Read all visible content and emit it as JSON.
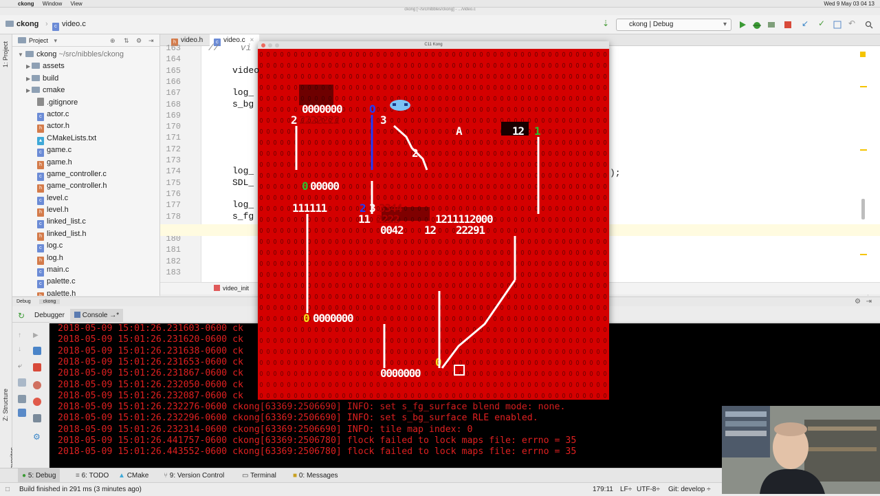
{
  "menubar": {
    "app": "ckong",
    "items": [
      "Window",
      "View"
    ],
    "clock": "Wed 9 May 03 04 13"
  },
  "window_title": "ckong [~/src/nibbles/ckong] - .../video.c",
  "navbar": {
    "project_crumb": "ckong",
    "file_crumb": "video.c",
    "run_config": "ckong | Debug"
  },
  "left_strip": {
    "project_tab": "1: Project",
    "structure_tab": "Z: Structure",
    "favorites_tab": "2: Favorites"
  },
  "project_panel": {
    "header": "Project",
    "root_name": "ckong",
    "root_path": "~/src/nibbles/ckong",
    "items": [
      {
        "label": "assets",
        "type": "folder"
      },
      {
        "label": "build",
        "type": "folder"
      },
      {
        "label": "cmake",
        "type": "folder"
      },
      {
        "label": ".gitignore",
        "type": "txt"
      },
      {
        "label": "actor.c",
        "type": "c"
      },
      {
        "label": "actor.h",
        "type": "h"
      },
      {
        "label": "CMakeLists.txt",
        "type": "cmake"
      },
      {
        "label": "game.c",
        "type": "c"
      },
      {
        "label": "game.h",
        "type": "h"
      },
      {
        "label": "game_controller.c",
        "type": "c"
      },
      {
        "label": "game_controller.h",
        "type": "h"
      },
      {
        "label": "level.c",
        "type": "c"
      },
      {
        "label": "level.h",
        "type": "h"
      },
      {
        "label": "linked_list.c",
        "type": "c"
      },
      {
        "label": "linked_list.h",
        "type": "h"
      },
      {
        "label": "log.c",
        "type": "c"
      },
      {
        "label": "log.h",
        "type": "h"
      },
      {
        "label": "main.c",
        "type": "c"
      },
      {
        "label": "palette.c",
        "type": "c"
      },
      {
        "label": "palette.h",
        "type": "h"
      }
    ]
  },
  "editor": {
    "tabs": [
      "video.h",
      "video.c"
    ],
    "line_numbers": [
      "163",
      "164",
      "165",
      "166",
      "167",
      "168",
      "169",
      "170",
      "171",
      "172",
      "173",
      "174",
      "175",
      "176",
      "177",
      "178",
      "179",
      "180",
      "181",
      "182",
      "183"
    ],
    "code": {
      "l163": "//    vi",
      "l165": "video",
      "l167": "log_",
      "l168": "s_bg",
      "l174": "log_",
      "l175": "SDL_",
      "l177": "log_",
      "l178": "s_fg"
    },
    "right_overflow": ");",
    "breadcrumb": "video_init"
  },
  "debug": {
    "label": "Debug",
    "config": "ckong",
    "tabs": [
      "Debugger",
      "Console"
    ],
    "log_lines": [
      "2018-05-09 15:01:26.231603-0600 ck",
      "2018-05-09 15:01:26.231620-0600 ck",
      "2018-05-09 15:01:26.231638-0600 ck",
      "2018-05-09 15:01:26.231653-0600 ck",
      "2018-05-09 15:01:26.231867-0600 ck",
      "2018-05-09 15:01:26.232050-0600 ck",
      "2018-05-09 15:01:26.232087-0600 ck",
      "2018-05-09 15:01:26.232276-0600 ckong[63369:2506690] INFO: set s_fg_surface blend mode: none.",
      "2018-05-09 15:01:26.232296-0600 ckong[63369:2506690] INFO: set s_bg_surface RLE enabled.",
      "2018-05-09 15:01:26.232314-0600 ckong[63369:2506690] INFO: tile map index: 0",
      "2018-05-09 15:01:26.441757-0600 ckong[63369:2506780] flock failed to lock maps file: errno = 35",
      "2018-05-09 15:01:26.443552-0600 ckong[63369:2506780] flock failed to lock maps file: errno = 35"
    ]
  },
  "bottom_tabs": [
    "5: Debug",
    "6: TODO",
    "CMake",
    "9: Version Control",
    "Terminal",
    "0: Messages"
  ],
  "status": {
    "message": "Build finished in 291 ms (3 minutes ago)",
    "position": "179:11",
    "line_sep": "LF÷",
    "encoding": "UTF-8÷",
    "git": "Git: develop ÷"
  },
  "game": {
    "title": "C11 Kong",
    "rows": [
      {
        "text": "0000000",
        "color": "white"
      },
      {
        "text": "2",
        "color": "white"
      },
      {
        "text": "2222222",
        "color": "dark"
      },
      {
        "text": "3",
        "color": "white"
      },
      {
        "text": "A",
        "color": "white"
      },
      {
        "text": "12",
        "color": "white"
      },
      {
        "text": "1",
        "color": "green"
      },
      {
        "text": "2",
        "color": "white"
      },
      {
        "text": "00000",
        "color": "white"
      },
      {
        "text": "0",
        "color": "green"
      },
      {
        "text": "111111",
        "color": "white"
      },
      {
        "text": "2",
        "color": "blue"
      },
      {
        "text": "3",
        "color": "white"
      },
      {
        "text": "3344",
        "color": "dark"
      },
      {
        "text": "11",
        "color": "white"
      },
      {
        "text": "2222",
        "color": "dark"
      },
      {
        "text": "1211112000",
        "color": "white"
      },
      {
        "text": "0042",
        "color": "white"
      },
      {
        "text": "12",
        "color": "white"
      },
      {
        "text": "22291",
        "color": "white"
      },
      {
        "text": "0000000",
        "color": "white"
      },
      {
        "text": "0",
        "color": "yellow"
      },
      {
        "text": "0000000",
        "color": "white"
      },
      {
        "text": "0",
        "color": "yellow"
      }
    ]
  }
}
